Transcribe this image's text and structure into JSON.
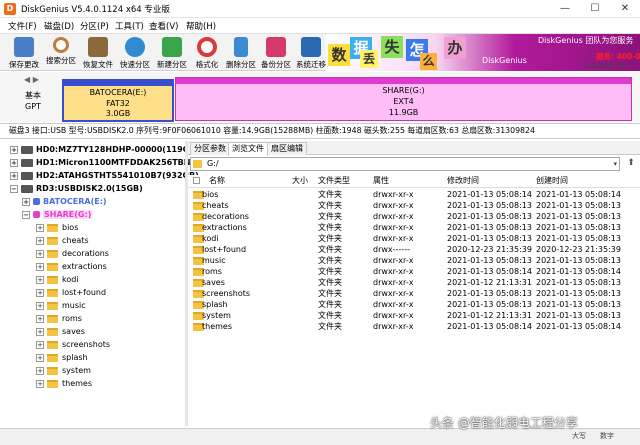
{
  "window": {
    "title": "DiskGenius V5.4.0.1124 x64 专业版",
    "minimize": "—",
    "maximize": "☐",
    "close": "✕"
  },
  "menu": [
    "文件(F)",
    "磁盘(D)",
    "分区(P)",
    "工具(T)",
    "查看(V)",
    "帮助(H)"
  ],
  "toolbar": [
    {
      "label": "保存更改",
      "icon": "save-icon",
      "color": "#4a7ec8"
    },
    {
      "label": "搜索分区",
      "icon": "search-icon",
      "color": "#c47a3a"
    },
    {
      "label": "恢复文件",
      "icon": "recover-icon",
      "color": "#8a6a3a"
    },
    {
      "label": "快速分区",
      "icon": "quick-partition-icon",
      "color": "#2e8bd4"
    },
    {
      "label": "新建分区",
      "icon": "new-partition-icon",
      "color": "#3aa64a"
    },
    {
      "label": "格式化",
      "icon": "format-icon",
      "color": "#d93a3a"
    },
    {
      "label": "删除分区",
      "icon": "delete-icon",
      "color": "#3a8ad4"
    },
    {
      "label": "备份分区",
      "icon": "backup-icon",
      "color": "#d43a6a"
    },
    {
      "label": "系统迁移",
      "icon": "migrate-icon",
      "color": "#2a6ab4"
    }
  ],
  "banner": {
    "chars": [
      "数",
      "据",
      "丢",
      "失",
      "怎",
      "么",
      "办"
    ],
    "service_text": "DiskGenius 团队为您服务",
    "brand": "DiskGenius",
    "phone": "服务: 400-008-",
    "tagline": "或点击此处立即..."
  },
  "diskmap": {
    "arrows": "◀ ▶",
    "type_line1": "基本",
    "type_line2": "GPT",
    "partitions": [
      {
        "name": "BATOCERA(E:)",
        "fs": "FAT32",
        "size": "3.0GB",
        "color": "#ffe08a"
      },
      {
        "name": "SHARE(G:)",
        "fs": "EXT4",
        "size": "11.9GB",
        "color": "#ffbdf7"
      }
    ]
  },
  "disk_info": "磁盘3 接口:USB  型号:USBDISK2.0  序列号:9F0F06061010  容量:14.9GB(15288MB)  柱面数:1948  磁头数:255  每道扇区数:63  总扇区数:31309824",
  "tree": {
    "disks": [
      {
        "label": "HD0:MZ7TY128HDHP-00000(119GB)",
        "toggle": "+"
      },
      {
        "label": "HD1:Micron1100MTFDDAK256TBN(2",
        "toggle": "+"
      },
      {
        "label": "HD2:ATAHGSTHTS541010B7(932GB)",
        "toggle": "+"
      },
      {
        "label": "RD3:USBDISK2.0(15GB)",
        "toggle": "−"
      }
    ],
    "partitions": [
      {
        "label": "BATOCERA(E:)",
        "toggle": "+",
        "color": "#4a6ee0"
      },
      {
        "label": "SHARE(G:)",
        "toggle": "−",
        "color": "#e040d0"
      }
    ],
    "folders": [
      "bios",
      "cheats",
      "decorations",
      "extractions",
      "kodi",
      "lost+found",
      "music",
      "roms",
      "saves",
      "screenshots",
      "splash",
      "system",
      "themes"
    ]
  },
  "tabs": [
    "分区参数",
    "浏览文件",
    "扇区编辑"
  ],
  "path": {
    "value": "G:/",
    "dropdown": "▾",
    "up": "⬆"
  },
  "columns": {
    "name": "名称",
    "size": "大小",
    "type": "文件类型",
    "attr": "属性",
    "modified": "修改时间",
    "created": "创建时间"
  },
  "files": [
    {
      "name": "bios",
      "type": "文件夹",
      "attr": "drwxr-xr-x",
      "modified": "2021-01-13 05:08:14",
      "created": "2021-01-13 05:08:14"
    },
    {
      "name": "cheats",
      "type": "文件夹",
      "attr": "drwxr-xr-x",
      "modified": "2021-01-13 05:08:13",
      "created": "2021-01-13 05:08:13"
    },
    {
      "name": "decorations",
      "type": "文件夹",
      "attr": "drwxr-xr-x",
      "modified": "2021-01-13 05:08:13",
      "created": "2021-01-13 05:08:13"
    },
    {
      "name": "extractions",
      "type": "文件夹",
      "attr": "drwxr-xr-x",
      "modified": "2021-01-13 05:08:13",
      "created": "2021-01-13 05:08:13"
    },
    {
      "name": "kodi",
      "type": "文件夹",
      "attr": "drwxr-xr-x",
      "modified": "2021-01-13 05:08:13",
      "created": "2021-01-13 05:08:13"
    },
    {
      "name": "lost+found",
      "type": "文件夹",
      "attr": "drwx------",
      "modified": "2020-12-23 21:35:39",
      "created": "2020-12-23 21:35:39"
    },
    {
      "name": "music",
      "type": "文件夹",
      "attr": "drwxr-xr-x",
      "modified": "2021-01-13 05:08:13",
      "created": "2021-01-13 05:08:13"
    },
    {
      "name": "roms",
      "type": "文件夹",
      "attr": "drwxr-xr-x",
      "modified": "2021-01-13 05:08:14",
      "created": "2021-01-13 05:08:14"
    },
    {
      "name": "saves",
      "type": "文件夹",
      "attr": "drwxr-xr-x",
      "modified": "2021-01-12 21:13:31",
      "created": "2021-01-13 05:08:13"
    },
    {
      "name": "screenshots",
      "type": "文件夹",
      "attr": "drwxr-xr-x",
      "modified": "2021-01-13 05:08:13",
      "created": "2021-01-13 05:08:13"
    },
    {
      "name": "splash",
      "type": "文件夹",
      "attr": "drwxr-xr-x",
      "modified": "2021-01-13 05:08:13",
      "created": "2021-01-13 05:08:13"
    },
    {
      "name": "system",
      "type": "文件夹",
      "attr": "drwxr-xr-x",
      "modified": "2021-01-12 21:13:31",
      "created": "2021-01-13 05:08:13"
    },
    {
      "name": "themes",
      "type": "文件夹",
      "attr": "drwxr-xr-x",
      "modified": "2021-01-13 05:08:14",
      "created": "2021-01-13 05:08:14"
    }
  ],
  "status": {
    "caps": "大写",
    "num": "数字"
  },
  "watermark": "头条 @智能化弱电工程分享"
}
